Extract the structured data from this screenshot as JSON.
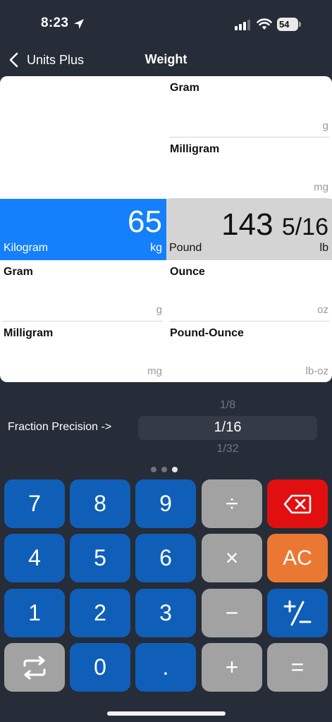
{
  "status": {
    "time": "8:23",
    "battery": "54"
  },
  "nav": {
    "back_label": "Units Plus",
    "title": "Weight"
  },
  "panel": {
    "top_right": [
      {
        "name": "Gram",
        "abbr": "g"
      },
      {
        "name": "Milligram",
        "abbr": "mg"
      }
    ],
    "input": {
      "value": "65",
      "name": "Kilogram",
      "abbr": "kg"
    },
    "output": {
      "value_whole": "143",
      "value_fraction": "5/16",
      "name": "Pound",
      "abbr": "lb"
    },
    "bottom_left": [
      {
        "name": "Gram",
        "abbr": "g"
      },
      {
        "name": "Milligram",
        "abbr": "mg"
      }
    ],
    "bottom_right": [
      {
        "name": "Ounce",
        "abbr": "oz"
      },
      {
        "name": "Pound-Ounce",
        "abbr": "lb-oz"
      }
    ]
  },
  "fraction_precision": {
    "label": "Fraction Precision ->",
    "options_visible": [
      "1/8",
      "1/16",
      "1/32"
    ],
    "selected": "1/16"
  },
  "page_dots": {
    "count": 3,
    "active_index": 2
  },
  "keypad": {
    "rows": [
      [
        "7",
        "8",
        "9",
        "÷",
        "backspace"
      ],
      [
        "4",
        "5",
        "6",
        "×",
        "AC"
      ],
      [
        "1",
        "2",
        "3",
        "−",
        "+/−"
      ],
      [
        "swap",
        "0",
        ".",
        "+",
        "="
      ]
    ],
    "labels": {
      "k7": "7",
      "k8": "8",
      "k9": "9",
      "divide": "÷",
      "k4": "4",
      "k5": "5",
      "k6": "6",
      "multiply": "×",
      "clear": "AC",
      "k1": "1",
      "k2": "2",
      "k3": "3",
      "minus": "−",
      "k0": "0",
      "dot": ".",
      "plus": "+",
      "equals": "="
    },
    "colors": {
      "digit": "#0f5fb8",
      "operator": "#a2a2a2",
      "backspace": "#e20f10",
      "clear": "#ea7833",
      "active_unit": "#1480fb"
    },
    "icons": {
      "backspace": "backspace-icon",
      "swap": "swap-icon",
      "sign": "plus-minus-icon"
    }
  }
}
